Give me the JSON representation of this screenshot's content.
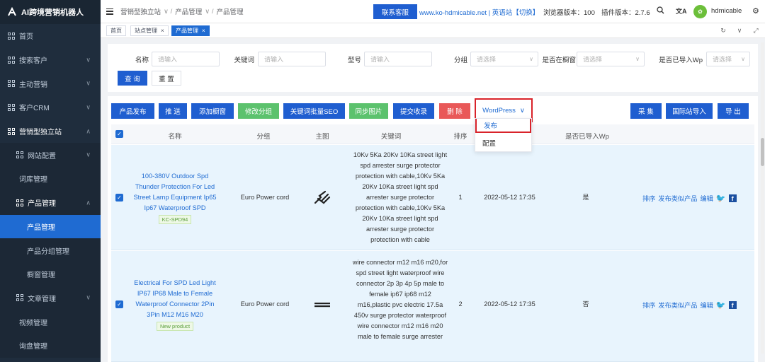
{
  "app": {
    "logo_text": "AI跨境营销机器人"
  },
  "sidebar": {
    "items": [
      {
        "label": "首页"
      },
      {
        "label": "搜索客户"
      },
      {
        "label": "主动营销"
      },
      {
        "label": "客户CRM"
      },
      {
        "label": "营销型独立站"
      },
      {
        "label": "网站配置"
      },
      {
        "label": "词库管理"
      },
      {
        "label": "产品管理"
      },
      {
        "label": "产品管理"
      },
      {
        "label": "产品分组管理"
      },
      {
        "label": "橱窗管理"
      },
      {
        "label": "文章管理"
      },
      {
        "label": "视频管理"
      },
      {
        "label": "询盘管理"
      }
    ]
  },
  "topbar": {
    "breadcrumb": [
      "营销型独立站",
      "产品管理",
      "产品管理"
    ],
    "service_button": "联系客服",
    "site_link": "www.ko-hdmicable.net | 英语站【切换】",
    "browser_version": "浏览器版本：100",
    "plugin_version": "插件版本：2.7.6",
    "username": "hdmicable"
  },
  "tabs": [
    {
      "label": "首页"
    },
    {
      "label": "站点管理"
    },
    {
      "label": "产品管理"
    }
  ],
  "filter": {
    "name_label": "名称",
    "name_placeholder": "请输入",
    "keyword_label": "关键词",
    "keyword_placeholder": "请输入",
    "model_label": "型号",
    "model_placeholder": "请输入",
    "group_label": "分组",
    "group_placeholder": "请选择",
    "window_label": "是否在橱窗",
    "window_placeholder": "请选择",
    "wp_label": "是否已导入Wp",
    "wp_placeholder": "请选择",
    "search_button": "查 询",
    "reset_button": "重 置"
  },
  "toolbar": {
    "publish": "产品发布",
    "push": "推 送",
    "add_window": "添加橱窗",
    "edit_group": "修改分组",
    "keyword_seo": "关键词批量SEO",
    "sync_images": "同步图片",
    "submit_index": "提交收录",
    "delete": "删 除",
    "wordpress": "WordPress",
    "wp_menu": [
      "发布",
      "配置"
    ],
    "collect": "采 集",
    "import_intl": "国际站导入",
    "export": "导 出"
  },
  "table": {
    "headers": {
      "name": "名称",
      "group": "分组",
      "image": "主图",
      "keywords": "关键词",
      "order": "排序",
      "wp": "是否已导入Wp"
    },
    "rows": [
      {
        "name": "100-380V Outdoor Spd Thunder Protection For Led Street Lamp Equipment Ip65 Ip67 Waterproof SPD",
        "tag": "KC-SPD94",
        "group": "Euro Power cord",
        "keywords": "10Kv 5Ka 20Kv 10Ka street light spd arrester surge protector protection with cable,10Kv 5Ka 20Kv 10Ka street light spd arrester surge protector protection with cable,10Kv 5Ka 20Kv 10Ka street light spd arrester surge protector protection with cable",
        "order": "1",
        "date": "2022-05-12 17:35",
        "wp": "是",
        "actions": [
          "排序",
          "发布类似产品",
          "编辑"
        ]
      },
      {
        "name": "Electrical For SPD Led Light IP67 IP68 Male to Female Waterproof Connector 2Pin 3Pin M12 M16 M20",
        "tag": "New product",
        "group": "Euro Power cord",
        "keywords": "wire connector m12 m16 m20,for spd street light waterproof wire connector 2p 3p 4p 5p male to female ip67 ip68 m12 m16,plastic pvc electric 17.5a 450v surge protector waterproof wire connector m12 m16 m20 male to female surge arrester",
        "order": "2",
        "date": "2022-05-12 17:35",
        "wp": "否",
        "actions": [
          "排序",
          "发布类似产品",
          "编辑"
        ]
      }
    ]
  },
  "colors": {
    "primary": "#1f5ed0",
    "green": "#5cc26d",
    "red": "#e95858",
    "sidebar": "#1f2d3d",
    "highlight_border": "#d9232a"
  }
}
